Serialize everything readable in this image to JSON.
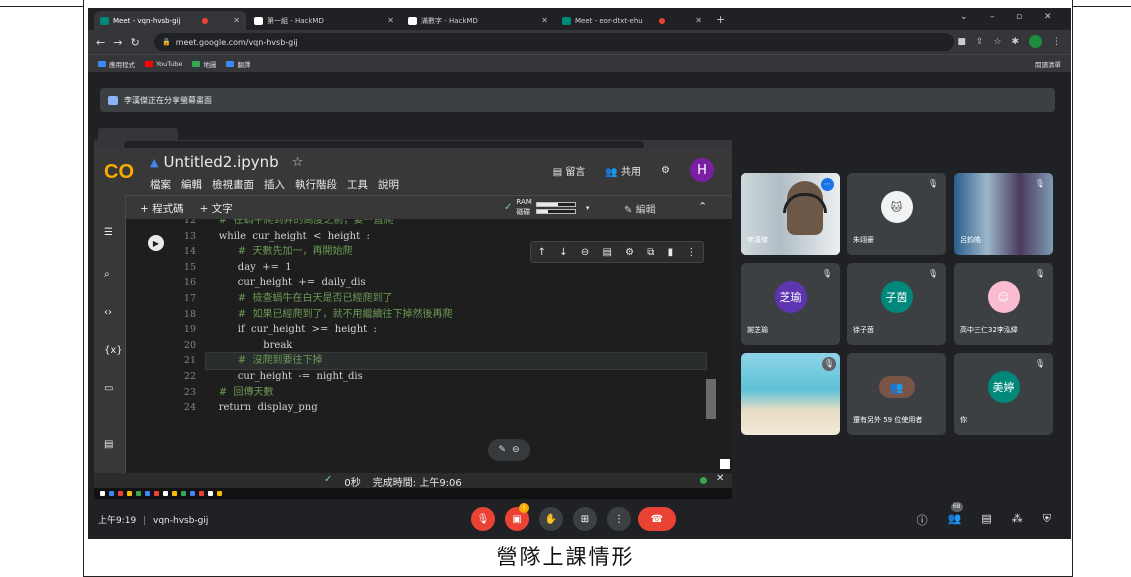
{
  "browser": {
    "tabs": [
      {
        "title": "Meet - vqn-hvsb-gij",
        "favicon_color": "#00897b",
        "recording": true
      },
      {
        "title": "第一組 - HackMD",
        "favicon_color": "#ffffff"
      },
      {
        "title": "滿數字 - HackMD",
        "favicon_color": "#ffffff"
      },
      {
        "title": "Meet - eor-dtxt-ehu",
        "favicon_color": "#00897b",
        "recording": true
      }
    ],
    "new_tab_label": "+",
    "url": "meet.google.com/vqn-hvsb-gij",
    "bookmarks": [
      {
        "label": "應用程式",
        "color": "#4285f4"
      },
      {
        "label": "YouTube",
        "color": "#ff0000"
      },
      {
        "label": "地圖",
        "color": "#34a853"
      },
      {
        "label": "翻譯",
        "color": "#4285f4"
      }
    ],
    "reading_list": "閱讀清單"
  },
  "meet": {
    "share_banner": "李漢傑正在分享螢幕畫面",
    "meeting_time": "上午9:19",
    "meeting_code": "vqn-hvsb-gij",
    "participant_count": "68",
    "tiles": [
      {
        "name": "李漢傑",
        "type": "video"
      },
      {
        "name": "朱翊豪",
        "type": "avatar-image",
        "muted": true
      },
      {
        "name": "呂鈞皓",
        "type": "avatar-image",
        "muted": true
      },
      {
        "name": "謝芝瑜",
        "initials": "芝瑜",
        "color": "#5e35b1",
        "muted": true
      },
      {
        "name": "徐子茵",
        "initials": "子茵",
        "color": "#00897b",
        "muted": true
      },
      {
        "name": "高中三仁32李泓緯",
        "type": "avatar-image",
        "muted": true
      },
      {
        "name": "",
        "type": "beach-image",
        "muted": true
      },
      {
        "name": "還有另外 59 位使用者",
        "type": "group"
      },
      {
        "name": "你",
        "initials": "美婷",
        "color": "#00897b",
        "muted": true
      }
    ]
  },
  "colab": {
    "logo": "CO",
    "notebook_title": "Untitled2.ipynb",
    "menus": [
      "檔案",
      "編輯",
      "檢視畫面",
      "插入",
      "執行階段",
      "工具",
      "說明"
    ],
    "comment_label": "留言",
    "share_label": "共用",
    "user_initial": "H",
    "add_code": "+ 程式碼",
    "add_text": "+ 文字",
    "ram_label": "RAM",
    "disk_label": "磁碟",
    "ram_usage": 0.55,
    "disk_usage": 0.3,
    "edit_label": "編輯",
    "line_numbers": [
      "12",
      "13",
      "14",
      "15",
      "16",
      "17",
      "18",
      "19",
      "20",
      "21",
      "22",
      "23",
      "24"
    ],
    "code_lines": [
      "    #  在蝸牛爬到井的高度之前，要一直爬",
      "    while  cur_height  <  height  :",
      "          #  天數先加一，再開始爬",
      "          day  +=  1",
      "          cur_height  +=  daily_dis",
      "          #  檢查蝸牛在白天是否已經爬到了",
      "          #  如果已經爬到了，就不用繼續往下掉然後再爬",
      "          if  cur_height  >=  height  :",
      "                  break",
      "          #  沒爬到要往下掉",
      "          cur_height  -=  night_dis",
      "    #  回傳天數",
      "    return  display_png"
    ],
    "status_time": "0秒",
    "status_done": "完成時間: 上午9:06"
  },
  "caption": "營隊上課情形"
}
